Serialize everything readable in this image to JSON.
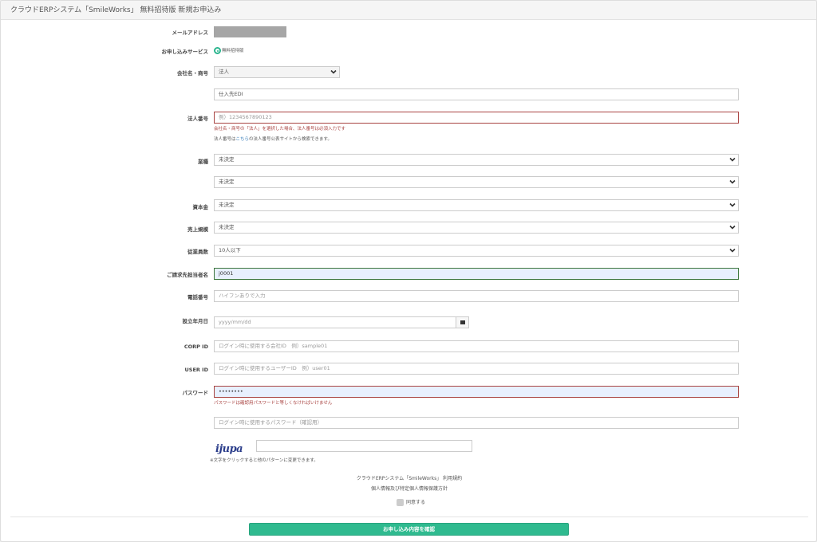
{
  "header": {
    "title": "クラウドERPシステム「SmileWorks」 無料招待版 新規お申込み"
  },
  "form": {
    "email_label": "メールアドレス",
    "service_label": "お申し込みサービス",
    "service_option": "無料招待版",
    "company_label": "会社名・商号",
    "company_type": "法人",
    "company_name": "仕入先EDI",
    "corp_number_label": "法人番号",
    "corp_number_placeholder": "例）1234567890123",
    "corp_number_error": "会社名・商号の「法人」を選択した場合、法人番号は必須入力です",
    "corp_number_note_prefix": "法人番号は",
    "corp_number_note_link": "こちら",
    "corp_number_note_suffix": "の法人番号公表サイトから検索できます。",
    "industry_label": "業種",
    "industry_value": "未決定",
    "industry_sub_value": "未決定",
    "capital_label": "資本金",
    "capital_value": "未決定",
    "sales_label": "売上規模",
    "sales_value": "未決定",
    "employees_label": "従業員数",
    "employees_value": "10人以下",
    "billing_contact_label": "ご請求先担当者名",
    "billing_contact_value": "j0001",
    "phone_label": "電話番号",
    "phone_placeholder": "ハイフンありで入力",
    "founded_label": "設立年月日",
    "founded_placeholder": "yyyy/mm/dd",
    "corp_id_label": "CORP ID",
    "corp_id_placeholder": "ログイン時に使用する会社ID　例）sample01",
    "user_id_label": "USER ID",
    "user_id_placeholder": "ログイン時に使用するユーザーID　例）user01",
    "password_label": "パスワード",
    "password_value": "••••••••",
    "password_error": "パスワードは確認用パスワードと等しくなければいけません",
    "password_confirm_placeholder": "ログイン時に使用するパスワード（確認用）",
    "captcha_text": "ijupa",
    "captcha_note": "※文字をクリックすると他のパターンに変更できます。",
    "terms_link": "クラウドERPシステム「SmileWorks」 利用規約",
    "privacy_link": "個人情報及び特定個人情報保護方針",
    "agree_label": "同意する",
    "submit_label": "お申し込み内容を確認"
  },
  "colors": {
    "accent": "#2fba8f",
    "error": "#a94442",
    "ok": "#3c763d",
    "link": "#337ab7"
  }
}
